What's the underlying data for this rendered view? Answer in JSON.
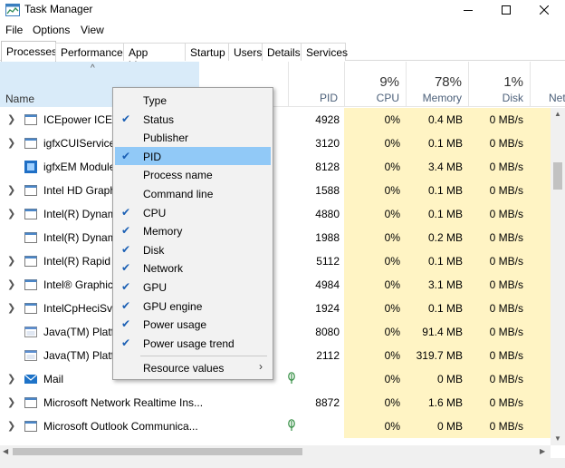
{
  "window": {
    "title": "Task Manager"
  },
  "menu": [
    "File",
    "Options",
    "View"
  ],
  "tabs": [
    "Processes",
    "Performance",
    "App history",
    "Startup",
    "Users",
    "Details",
    "Services"
  ],
  "columns": {
    "name": "Name",
    "pid": "PID",
    "cpu": {
      "pct": "9%",
      "label": "CPU"
    },
    "memory": {
      "pct": "78%",
      "label": "Memory"
    },
    "disk": {
      "pct": "1%",
      "label": "Disk"
    },
    "network": {
      "label": "Net"
    }
  },
  "rows": [
    {
      "name": "ICEpower ICEso",
      "pid": "4928",
      "cpu": "0%",
      "mem": "0.4 MB",
      "disk": "0 MB/s",
      "expand": true,
      "icon": "box"
    },
    {
      "name": "igfxCUIService M",
      "pid": "3120",
      "cpu": "0%",
      "mem": "0.1 MB",
      "disk": "0 MB/s",
      "expand": true,
      "icon": "box"
    },
    {
      "name": "igfxEM Module",
      "pid": "8128",
      "cpu": "0%",
      "mem": "3.4 MB",
      "disk": "0 MB/s",
      "expand": false,
      "icon": "blue"
    },
    {
      "name": "Intel HD Graphi",
      "pid": "1588",
      "cpu": "0%",
      "mem": "0.1 MB",
      "disk": "0 MB/s",
      "expand": true,
      "icon": "box"
    },
    {
      "name": "Intel(R) Dynami",
      "pid": "4880",
      "cpu": "0%",
      "mem": "0.1 MB",
      "disk": "0 MB/s",
      "expand": true,
      "icon": "box"
    },
    {
      "name": "Intel(R) Dynami",
      "pid": "1988",
      "cpu": "0%",
      "mem": "0.2 MB",
      "disk": "0 MB/s",
      "expand": false,
      "icon": "box"
    },
    {
      "name": "Intel(R) Rapid St",
      "pid": "5112",
      "cpu": "0%",
      "mem": "0.1 MB",
      "disk": "0 MB/s",
      "expand": true,
      "icon": "box"
    },
    {
      "name": "Intel® Graphics",
      "pid": "4984",
      "cpu": "0%",
      "mem": "3.1 MB",
      "disk": "0 MB/s",
      "expand": true,
      "icon": "box"
    },
    {
      "name": "IntelCpHeciSvc",
      "pid": "1924",
      "cpu": "0%",
      "mem": "0.1 MB",
      "disk": "0 MB/s",
      "expand": true,
      "icon": "box"
    },
    {
      "name": "Java(TM) Platfo",
      "pid": "8080",
      "cpu": "0%",
      "mem": "91.4 MB",
      "disk": "0 MB/s",
      "expand": false,
      "icon": "java"
    },
    {
      "name": "Java(TM) Platfo",
      "pid": "2112",
      "cpu": "0%",
      "mem": "319.7 MB",
      "disk": "0 MB/s",
      "expand": false,
      "icon": "java"
    },
    {
      "name": "Mail",
      "pid": "",
      "cpu": "0%",
      "mem": "0 MB",
      "disk": "0 MB/s",
      "expand": true,
      "icon": "mail",
      "leaf": true
    },
    {
      "name": "Microsoft Network Realtime Ins...",
      "pid": "8872",
      "cpu": "0%",
      "mem": "1.6 MB",
      "disk": "0 MB/s",
      "expand": true,
      "icon": "box"
    },
    {
      "name": "Microsoft Outlook Communica...",
      "pid": "",
      "cpu": "0%",
      "mem": "0 MB",
      "disk": "0 MB/s",
      "expand": true,
      "icon": "box",
      "leaf": true
    }
  ],
  "context_menu": [
    {
      "label": "Type",
      "checked": false
    },
    {
      "label": "Status",
      "checked": true
    },
    {
      "label": "Publisher",
      "checked": false
    },
    {
      "label": "PID",
      "checked": true,
      "highlighted": true
    },
    {
      "label": "Process name",
      "checked": false
    },
    {
      "label": "Command line",
      "checked": false
    },
    {
      "label": "CPU",
      "checked": true
    },
    {
      "label": "Memory",
      "checked": true
    },
    {
      "label": "Disk",
      "checked": true
    },
    {
      "label": "Network",
      "checked": true
    },
    {
      "label": "GPU",
      "checked": true
    },
    {
      "label": "GPU engine",
      "checked": true
    },
    {
      "label": "Power usage",
      "checked": true
    },
    {
      "label": "Power usage trend",
      "checked": true
    },
    {
      "label": "Resource values",
      "checked": false,
      "submenu": true
    }
  ],
  "colors": {
    "heat": "#fff4c4",
    "sortHeader": "#d9ebf9",
    "menuHighlight": "#91c9f7",
    "checkmark": "#1a5fb4"
  }
}
